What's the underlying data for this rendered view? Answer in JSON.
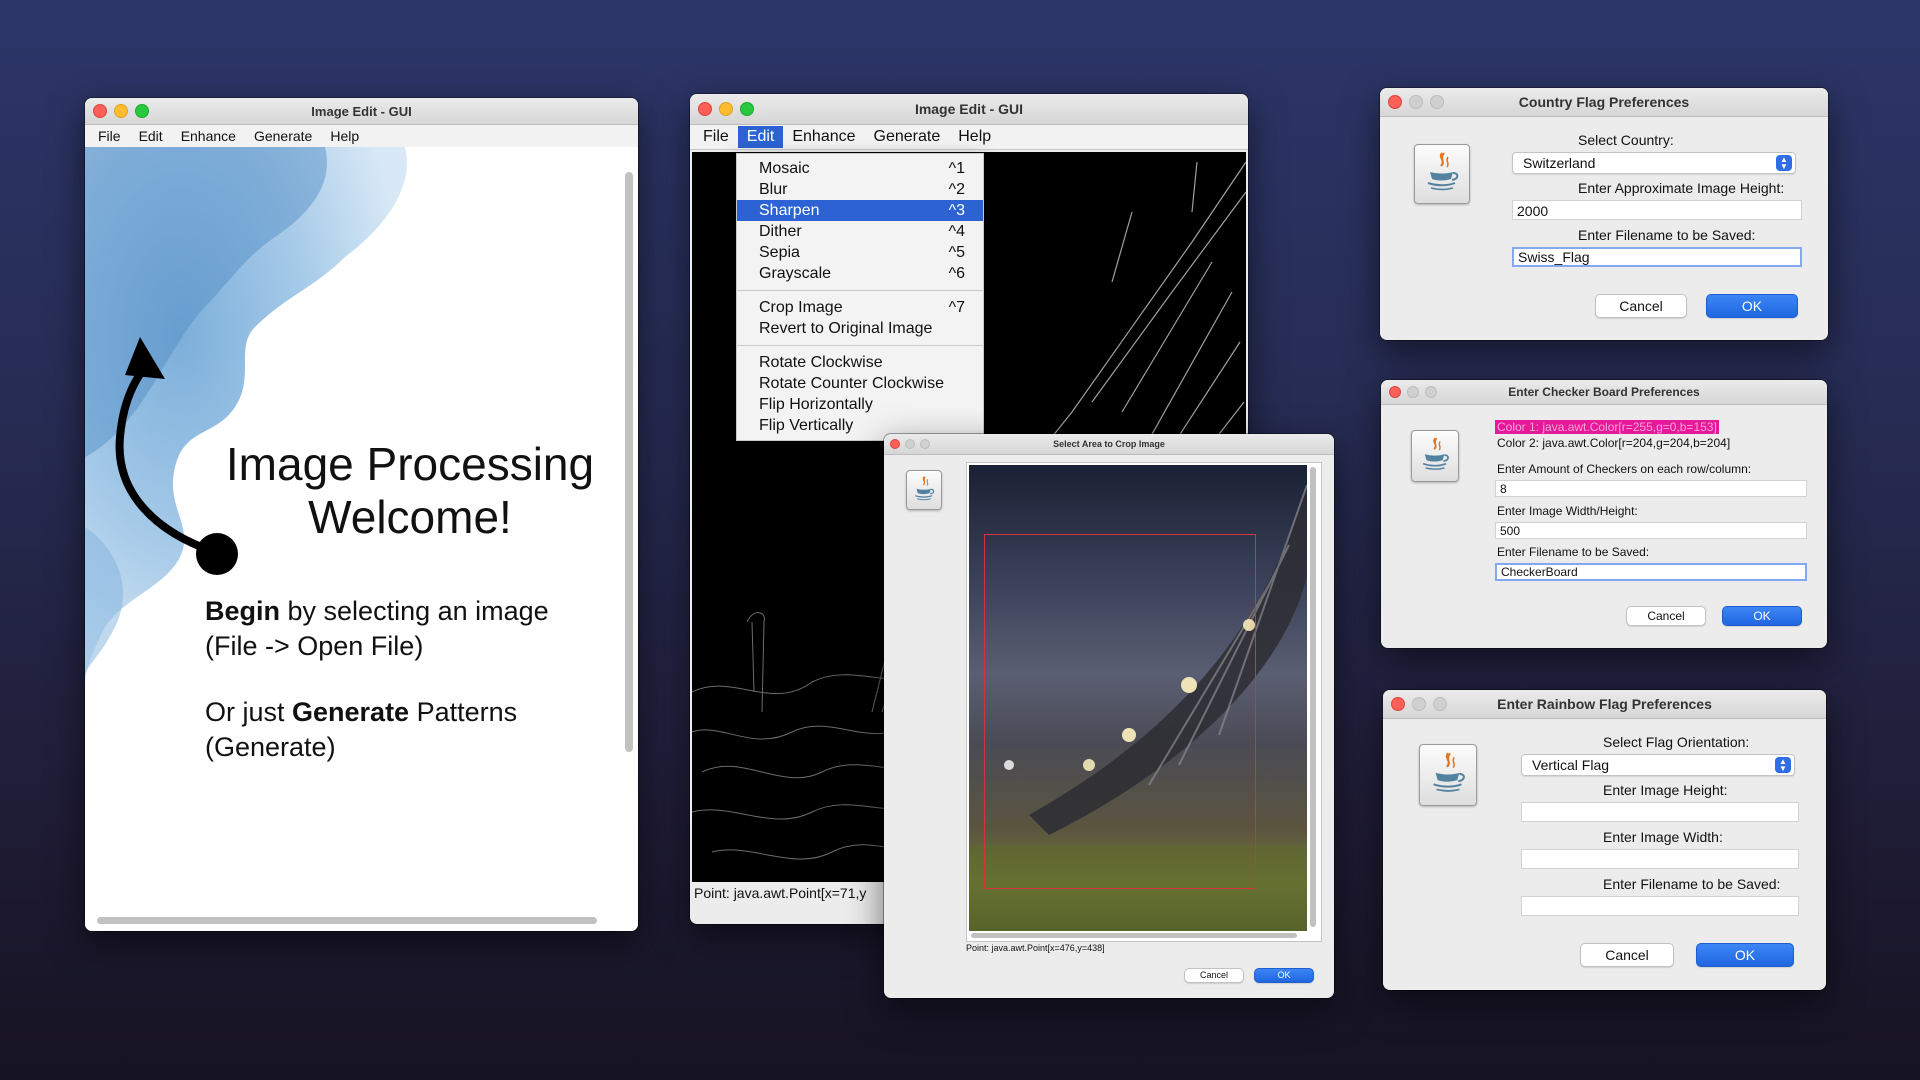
{
  "window1": {
    "title": "Image Edit - GUI",
    "menu": [
      "File",
      "Edit",
      "Enhance",
      "Generate",
      "Help"
    ],
    "welcome_line1": "Image Processing",
    "welcome_line2": "Welcome!",
    "begin_bold": "Begin",
    "begin_rest": " by selecting an image",
    "begin_line2": "(File -> Open File)",
    "or_prefix": "Or just ",
    "or_bold": "Generate",
    "or_rest": " Patterns",
    "or_line2": "(Generate)"
  },
  "window2": {
    "title": "Image Edit - GUI",
    "menu": [
      "File",
      "Edit",
      "Enhance",
      "Generate",
      "Help"
    ],
    "active_menu": "Edit",
    "status": "Point: java.awt.Point[x=71,y",
    "edit_menu": {
      "group1": [
        {
          "label": "Mosaic",
          "key": "^1"
        },
        {
          "label": "Blur",
          "key": "^2"
        },
        {
          "label": "Sharpen",
          "key": "^3",
          "selected": true
        },
        {
          "label": "Dither",
          "key": "^4"
        },
        {
          "label": "Sepia",
          "key": "^5"
        },
        {
          "label": "Grayscale",
          "key": "^6"
        }
      ],
      "group2": [
        {
          "label": "Crop Image",
          "key": "^7"
        },
        {
          "label": "Revert to Original Image",
          "key": ""
        }
      ],
      "group3": [
        {
          "label": "Rotate Clockwise"
        },
        {
          "label": "Rotate Counter Clockwise"
        },
        {
          "label": "Flip Horizontally"
        },
        {
          "label": "Flip Vertically"
        }
      ]
    }
  },
  "crop_dialog": {
    "title": "Select Area to Crop Image",
    "status": "Point: java.awt.Point[x=476,y=438]",
    "cancel": "Cancel",
    "ok": "OK"
  },
  "country_dialog": {
    "title": "Country Flag Preferences",
    "select_label": "Select Country:",
    "select_value": "Switzerland",
    "height_label": "Enter Approximate Image Height:",
    "height_value": "2000",
    "filename_label": "Enter Filename to be Saved:",
    "filename_value": "Swiss_Flag",
    "cancel": "Cancel",
    "ok": "OK"
  },
  "checker_dialog": {
    "title": "Enter Checker Board Preferences",
    "color1": "Color 1: java.awt.Color[r=255,g=0,b=153]",
    "color2": "Color 2: java.awt.Color[r=204,g=204,b=204]",
    "amount_label": "Enter Amount of Checkers on each row/column:",
    "amount_value": "8",
    "size_label": "Enter Image Width/Height:",
    "size_value": "500",
    "filename_label": "Enter Filename to be Saved:",
    "filename_value": "CheckerBoard",
    "cancel": "Cancel",
    "ok": "OK",
    "highlight_color": "#e6199a"
  },
  "rainbow_dialog": {
    "title": "Enter Rainbow Flag Preferences",
    "orientation_label": "Select Flag Orientation:",
    "orientation_value": "Vertical Flag",
    "height_label": "Enter Image Height:",
    "width_label": "Enter Image Width:",
    "filename_label": "Enter Filename to be Saved:",
    "cancel": "Cancel",
    "ok": "OK"
  },
  "icons": [
    "java-cup-icon",
    "select-arrows-icon",
    "arrow-icon"
  ]
}
